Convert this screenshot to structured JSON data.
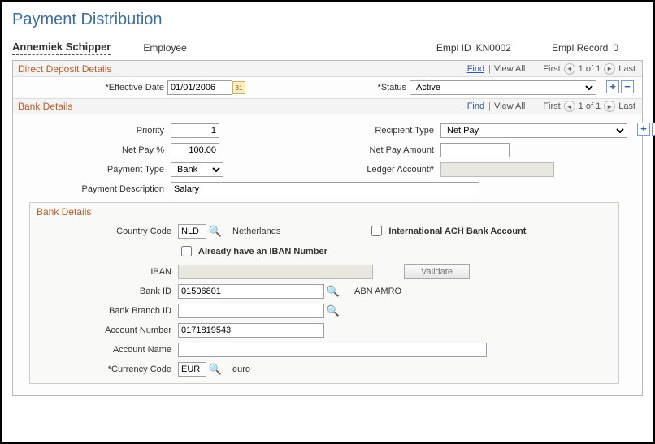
{
  "page": {
    "title": "Payment Distribution"
  },
  "header": {
    "name": "Annemiek Schipper",
    "type": "Employee",
    "empl_id_label": "Empl ID",
    "empl_id": "KN0002",
    "empl_record_label": "Empl Record",
    "empl_record": "0"
  },
  "nav": {
    "find": "Find",
    "view_all": "View All",
    "first": "First",
    "of": "1 of 1",
    "last": "Last"
  },
  "dd": {
    "title": "Direct Deposit Details",
    "eff_date_label": "Effective Date",
    "eff_date": "01/01/2006",
    "status_label": "Status",
    "status": "Active"
  },
  "bank": {
    "title": "Bank Details",
    "priority_label": "Priority",
    "priority": "1",
    "recipient_label": "Recipient Type",
    "recipient": "Net Pay",
    "netpaypct_label": "Net Pay %",
    "netpaypct": "100.00",
    "netpayamt_label": "Net Pay Amount",
    "netpayamt": "",
    "paytype_label": "Payment Type",
    "paytype": "Bank",
    "ledger_label": "Ledger Account#",
    "ledger": "",
    "paydesc_label": "Payment Description",
    "paydesc": "Salary"
  },
  "details": {
    "title": "Bank Details",
    "country_label": "Country Code",
    "country": "NLD",
    "country_name": "Netherlands",
    "intl_ach_label": "International ACH Bank Account",
    "have_iban_label": "Already have an IBAN Number",
    "iban_label": "IBAN",
    "iban": "",
    "validate": "Validate",
    "bankid_label": "Bank ID",
    "bankid": "01506801",
    "bankid_desc": "ABN AMRO",
    "branch_label": "Bank Branch ID",
    "branch": "",
    "acctnum_label": "Account Number",
    "acctnum": "0171819543",
    "acctname_label": "Account Name",
    "acctname": "",
    "currency_label": "Currency Code",
    "currency": "EUR",
    "currency_name": "euro"
  }
}
